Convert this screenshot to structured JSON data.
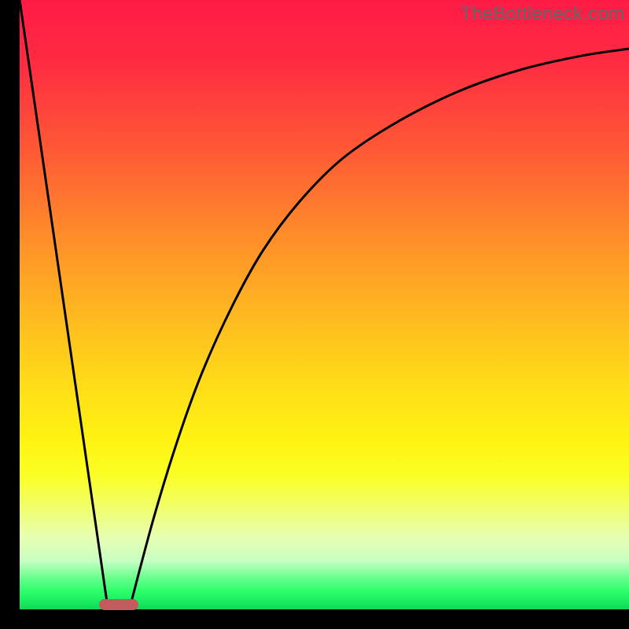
{
  "watermark": "TheBottleneck.com",
  "colors": {
    "frame": "#000000",
    "marker": "#c25b5b",
    "curve": "#000000"
  },
  "chart_data": {
    "type": "line",
    "title": "",
    "xlabel": "",
    "ylabel": "",
    "xlim": [
      0,
      100
    ],
    "ylim": [
      0,
      100
    ],
    "grid": false,
    "legend": false,
    "series": [
      {
        "name": "left-branch",
        "x": [
          0,
          14.5
        ],
        "y": [
          100,
          0
        ]
      },
      {
        "name": "right-branch",
        "x": [
          18,
          22,
          26,
          30,
          35,
          40,
          46,
          53,
          62,
          72,
          82,
          92,
          100
        ],
        "y": [
          0,
          15,
          28,
          39,
          50,
          59,
          67,
          74,
          80,
          85,
          88.5,
          90.8,
          92
        ]
      }
    ],
    "marker": {
      "x_start": 13,
      "x_end": 19.5,
      "y": 0.5
    },
    "gradient_stops": [
      {
        "offset": 0,
        "color": "#ff1a45"
      },
      {
        "offset": 50,
        "color": "#ffb321"
      },
      {
        "offset": 78,
        "color": "#fbff24"
      },
      {
        "offset": 100,
        "color": "#12d656"
      }
    ]
  }
}
